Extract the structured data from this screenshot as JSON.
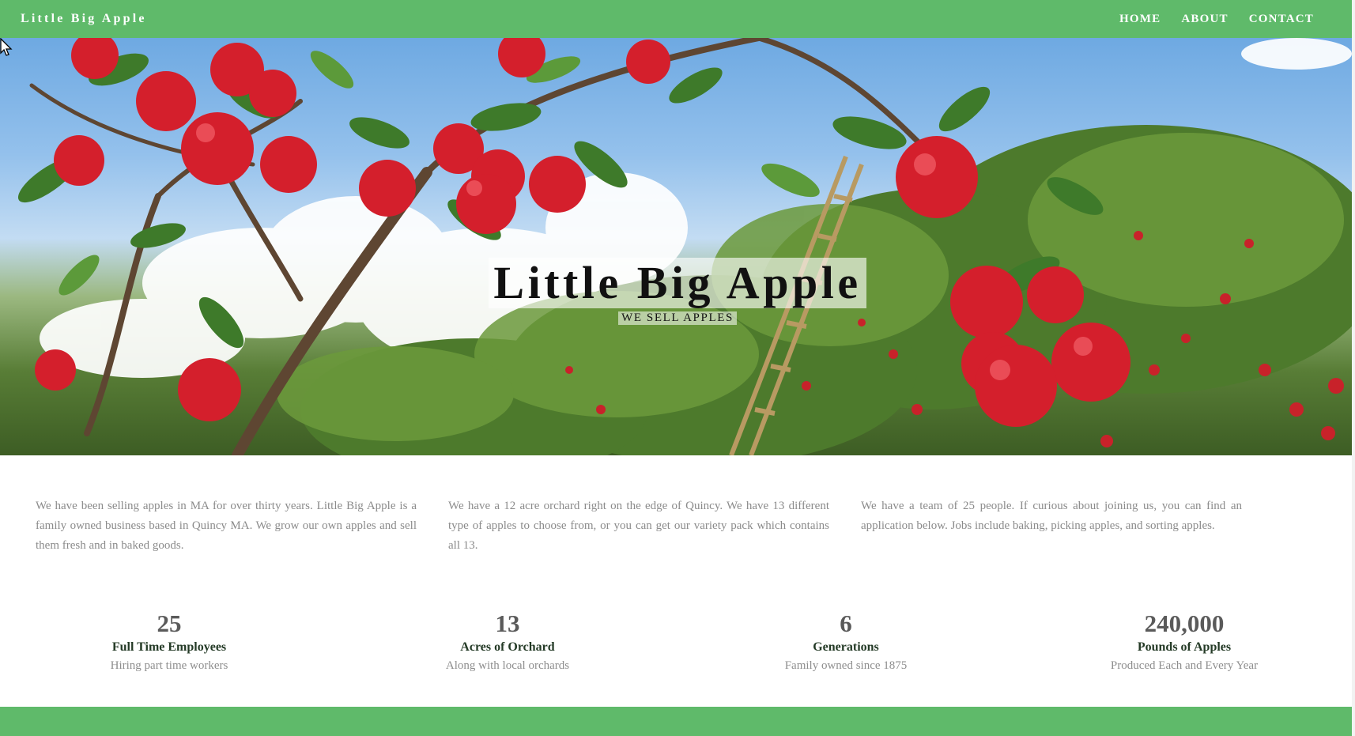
{
  "navbar": {
    "brand": "Little Big Apple",
    "links": [
      "HOME",
      "ABOUT",
      "CONTACT"
    ]
  },
  "hero": {
    "title": "Little Big Apple",
    "subtitle": "WE SELL APPLES"
  },
  "intro": [
    "We have been selling apples in MA for over thirty years. Little Big Apple is a family owned business based in Quincy MA. We grow our own apples and sell them fresh and in baked goods.",
    "We have a 12 acre orchard right on the edge of Quincy.  We have 13 different type of apples to choose from, or you can get our variety pack which contains all 13.",
    " We have a team of 25 people.  If curious about joining us, you can find an application below.  Jobs include baking, picking apples, and  sorting apples."
  ],
  "stats": [
    {
      "number": "25",
      "label": "Full Time Employees",
      "sub": "Hiring part time workers"
    },
    {
      "number": "13",
      "label": "Acres of Orchard",
      "sub": "Along with local orchards"
    },
    {
      "number": "6",
      "label": "Generations",
      "sub": "Family owned since 1875"
    },
    {
      "number": "240,000",
      "label": "Pounds of Apples",
      "sub": "Produced Each and Every Year"
    }
  ],
  "colors": {
    "brand_green": "#5fba6a",
    "text_gray": "#8b8b8b",
    "label_green": "#243a26"
  }
}
